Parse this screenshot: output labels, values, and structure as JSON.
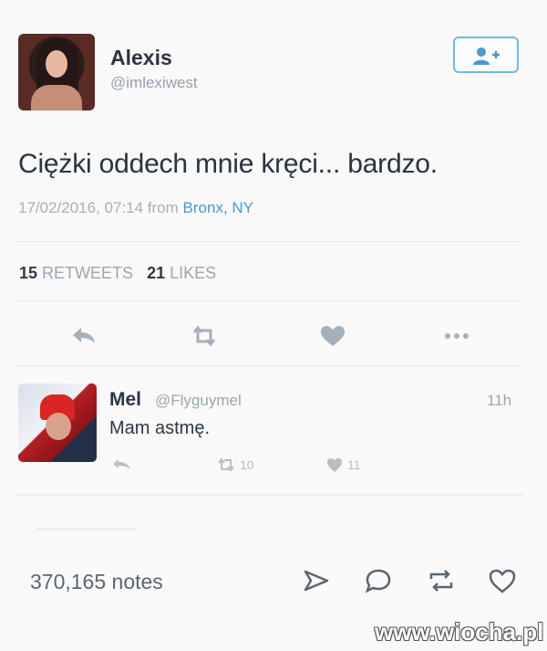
{
  "tweet": {
    "author_name": "Alexis",
    "author_handle": "@imlexiwest",
    "text": "Ciężki oddech mnie kręci... bardzo.",
    "date": "17/02/2016, 07:14 from ",
    "location": "Bronx, NY",
    "retweets_count": "15",
    "retweets_label": "RETWEETS",
    "likes_count": "21",
    "likes_label": "LIKES"
  },
  "reply": {
    "author_name": "Mel",
    "author_handle": "@Flyguymel",
    "time": "11h",
    "text": "Mam astmę.",
    "retweets": "10",
    "likes": "11"
  },
  "notes": {
    "count_text": "370,165 notes"
  },
  "watermark": "www.wiocha.pl",
  "colors": {
    "accent": "#4f97c9",
    "follow_border": "#76b6de",
    "icon_gray": "#a6b0ba"
  },
  "icons": [
    "follow-user-icon",
    "reply-icon",
    "retweet-icon",
    "heart-icon",
    "more-icon",
    "send-icon",
    "comment-icon",
    "reblog-icon",
    "like-icon"
  ]
}
